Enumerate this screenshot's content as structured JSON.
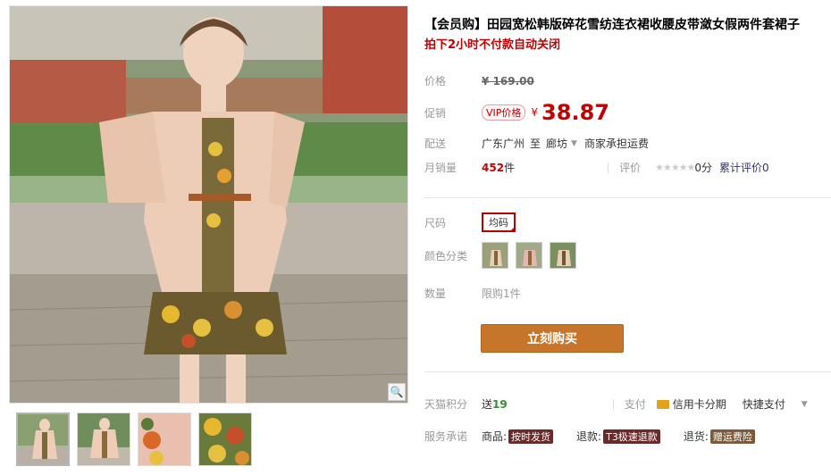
{
  "product": {
    "title": "【会员购】田园宽松韩版碎花雪纺连衣裙收腰皮带潋女假两件套裙子",
    "subtitle": "拍下2小时不付款自动关闭"
  },
  "price": {
    "label": "价格",
    "original": "¥ 169.00"
  },
  "promo": {
    "label": "促销",
    "badge": "VIP价格",
    "currency": "¥",
    "value": "38.87"
  },
  "shipping": {
    "label": "配送",
    "from": "广东广州",
    "to_word": "至",
    "destination": "廊坊",
    "note": "商家承担运费"
  },
  "sales": {
    "label": "月销量",
    "count": "452",
    "unit": "件",
    "rating_label": "评价",
    "rating_score": "0分",
    "reviews_link": "累计评价0"
  },
  "size": {
    "label": "尺码",
    "option": "均码"
  },
  "color": {
    "label": "颜色分类"
  },
  "quantity": {
    "label": "数量",
    "limit": "限购1件"
  },
  "buy_button": "立刻购买",
  "points": {
    "label": "天猫积分",
    "send": "送",
    "value": "19",
    "pay_label": "支付",
    "card_pay": "信用卡分期",
    "fast_pay": "快捷支付"
  },
  "service": {
    "label": "服务承诺",
    "goods_label": "商品:",
    "goods_tag": "按时发货",
    "refund_label": "退款:",
    "refund_tag": "T3极速退款",
    "return_label": "退货:",
    "return_tag": "赠运费险"
  },
  "colors": {
    "price_red": "#c40000",
    "buy_orange": "#c8752c"
  }
}
